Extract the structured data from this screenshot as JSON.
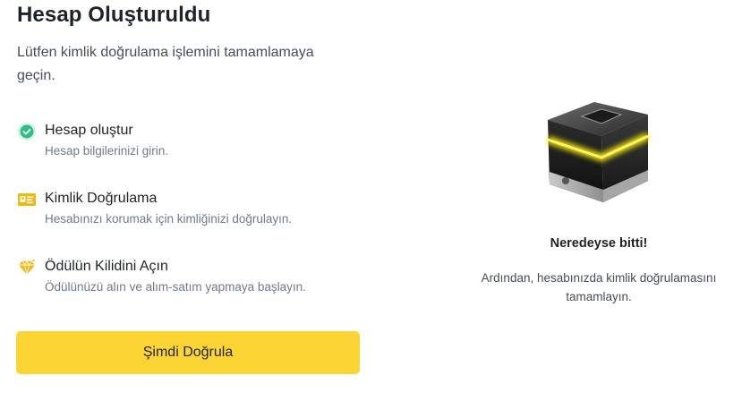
{
  "header": {
    "title": "Hesap Oluşturuldu",
    "subtitle": "Lütfen kimlik doğrulama işlemini tamamlamaya geçin."
  },
  "steps": [
    {
      "title": "Hesap oluştur",
      "description": "Hesap bilgilerinizi girin.",
      "icon": "check-circle-icon",
      "status": "completed"
    },
    {
      "title": "Kimlik Doğrulama",
      "description": "Hesabınızı korumak için kimliğinizi doğrulayın.",
      "icon": "id-card-icon"
    },
    {
      "title": "Ödülün Kilidini Açın",
      "description": "Ödülünüzü alın ve alım-satım yapmaya başlayın.",
      "icon": "diamond-icon"
    }
  ],
  "cta": {
    "label": "Şimdi Doğrula"
  },
  "panel": {
    "title": "Neredeyse bitti!",
    "description": "Ardından, hesabınızda kimlik doğrulamasını tamamlayın."
  },
  "colors": {
    "accent": "#fcd535",
    "success": "#2ebd85",
    "text_primary": "#1e2329",
    "text_secondary": "#707a8a"
  }
}
